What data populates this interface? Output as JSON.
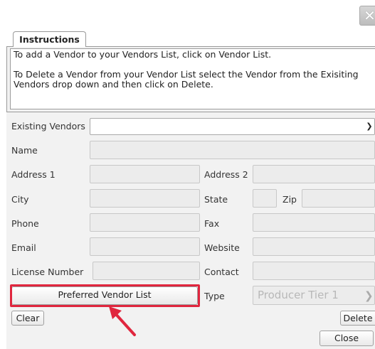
{
  "window": {
    "close_label": "✕"
  },
  "tabs": [
    {
      "label": "Instructions"
    }
  ],
  "instructions": {
    "line1": "To add a Vendor to your Vendors List, click on Vendor List.",
    "line2": "To Delete a Vendor from your Vendor List select the Vendor from the Exisiting Vendors drop down and then click on Delete."
  },
  "form": {
    "existing_vendors_label": "Existing Vendors",
    "existing_vendors_value": "",
    "name_label": "Name",
    "address1_label": "Address 1",
    "address2_label": "Address 2",
    "city_label": "City",
    "state_label": "State",
    "zip_label": "Zip",
    "phone_label": "Phone",
    "fax_label": "Fax",
    "email_label": "Email",
    "website_label": "Website",
    "license_label": "License Number",
    "contact_label": "Contact",
    "type_label": "Type",
    "type_value": "Producer Tier 1"
  },
  "buttons": {
    "preferred_vendor_list": "Preferred Vendor List",
    "clear": "Clear",
    "delete": "Delete",
    "close": "Close"
  },
  "colors": {
    "highlight": "#e0263e",
    "arrow": "#e0263e"
  }
}
